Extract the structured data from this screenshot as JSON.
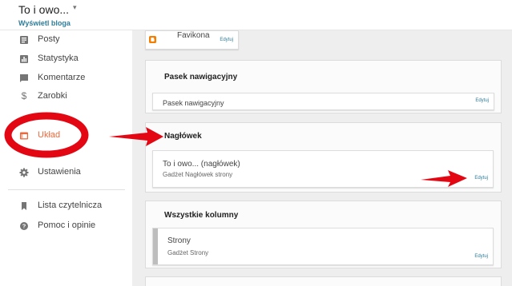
{
  "header": {
    "blog_title": "To i owo...",
    "view_blog": "Wyświetl bloga"
  },
  "sidebar": {
    "items": [
      {
        "label": "Posty",
        "icon": "posts-icon"
      },
      {
        "label": "Statystyka",
        "icon": "stats-icon"
      },
      {
        "label": "Komentarze",
        "icon": "comments-icon"
      },
      {
        "label": "Zarobki",
        "icon": "dollar-icon"
      },
      {
        "label": "Układ",
        "icon": "layout-icon",
        "active": true
      },
      {
        "label": "Ustawienia",
        "icon": "gear-icon"
      },
      {
        "label": "Lista czytelnicza",
        "icon": "bookmark-icon"
      },
      {
        "label": "Pomoc i opinie",
        "icon": "help-icon"
      }
    ]
  },
  "layout": {
    "favicon": {
      "title": "Favikona",
      "edit": "Edytuj"
    },
    "navbar_section": {
      "title": "Pasek nawigacyjny",
      "gadget": {
        "title": "Pasek nawigacyjny",
        "edit": "Edytuj"
      }
    },
    "header_section": {
      "title": "Nagłówek",
      "gadget": {
        "title": "To i owo... (nagłówek)",
        "subtitle": "Gadżet Nagłówek strony",
        "edit": "Edytuj"
      }
    },
    "columns_section": {
      "title": "Wszystkie kolumny",
      "gadget": {
        "title": "Strony",
        "subtitle": "Gadżet Strony",
        "edit": "Edytuj"
      }
    }
  },
  "colors": {
    "accent": "#ea6a3d",
    "link": "#2e7d9a",
    "annotation_red": "#e30613",
    "blogger_orange": "#f57d00"
  }
}
